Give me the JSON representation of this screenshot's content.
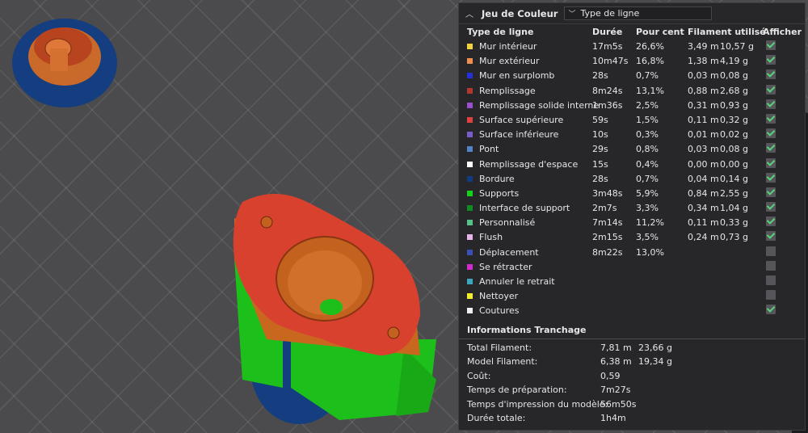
{
  "panel": {
    "title": "Jeu de Couleur",
    "dropdown_value": "Type de ligne",
    "headers": {
      "type": "Type de ligne",
      "duration": "Durée",
      "percent": "Pour cent",
      "filament": "Filament utilisé",
      "show": "Afficher"
    },
    "rows": [
      {
        "color": "#f0d33f",
        "name": "Mur intérieur",
        "duration": "17m5s",
        "percent": "26,6%",
        "length": "3,49 m",
        "weight": "10,57 g",
        "visible": true
      },
      {
        "color": "#ef8e4e",
        "name": "Mur extérieur",
        "duration": "10m47s",
        "percent": "16,8%",
        "length": "1,38 m",
        "weight": "4,19 g",
        "visible": true
      },
      {
        "color": "#2431d8",
        "name": "Mur en surplomb",
        "duration": "28s",
        "percent": "0,7%",
        "length": "0,03 m",
        "weight": "0,08 g",
        "visible": true
      },
      {
        "color": "#b3362f",
        "name": "Remplissage",
        "duration": "8m24s",
        "percent": "13,1%",
        "length": "0,88 m",
        "weight": "2,68 g",
        "visible": true
      },
      {
        "color": "#9a4fd1",
        "name": "Remplissage solide interne",
        "duration": "1m36s",
        "percent": "2,5%",
        "length": "0,31 m",
        "weight": "0,93 g",
        "visible": true
      },
      {
        "color": "#e0403f",
        "name": "Surface supérieure",
        "duration": "59s",
        "percent": "1,5%",
        "length": "0,11 m",
        "weight": "0,32 g",
        "visible": true
      },
      {
        "color": "#7b5ccf",
        "name": "Surface inférieure",
        "duration": "10s",
        "percent": "0,3%",
        "length": "0,01 m",
        "weight": "0,02 g",
        "visible": true
      },
      {
        "color": "#5283c4",
        "name": "Pont",
        "duration": "29s",
        "percent": "0,8%",
        "length": "0,03 m",
        "weight": "0,08 g",
        "visible": true
      },
      {
        "color": "#ffffff",
        "name": "Remplissage d'espace",
        "duration": "15s",
        "percent": "0,4%",
        "length": "0,00 m",
        "weight": "0,00 g",
        "visible": true
      },
      {
        "color": "#133b80",
        "name": "Bordure",
        "duration": "28s",
        "percent": "0,7%",
        "length": "0,04 m",
        "weight": "0,14 g",
        "visible": true
      },
      {
        "color": "#13d21c",
        "name": "Supports",
        "duration": "3m48s",
        "percent": "5,9%",
        "length": "0,84 m",
        "weight": "2,55 g",
        "visible": true
      },
      {
        "color": "#0f8a24",
        "name": "Interface de support",
        "duration": "2m7s",
        "percent": "3,3%",
        "length": "0,34 m",
        "weight": "1,04 g",
        "visible": true
      },
      {
        "color": "#56c28a",
        "name": "Personnalisé",
        "duration": "7m14s",
        "percent": "11,2%",
        "length": "0,11 m",
        "weight": "0,33 g",
        "visible": true
      },
      {
        "color": "#e8b3ea",
        "name": "Flush",
        "duration": "2m15s",
        "percent": "3,5%",
        "length": "0,24 m",
        "weight": "0,73 g",
        "visible": true
      },
      {
        "color": "#3c4fb5",
        "name": "Déplacement",
        "duration": "8m22s",
        "percent": "13,0%",
        "length": "",
        "weight": "",
        "visible": false
      },
      {
        "color": "#d22bcf",
        "name": "Se rétracter",
        "duration": "",
        "percent": "",
        "length": "",
        "weight": "",
        "visible": false
      },
      {
        "color": "#3aa6c2",
        "name": "Annuler le retrait",
        "duration": "",
        "percent": "",
        "length": "",
        "weight": "",
        "visible": false
      },
      {
        "color": "#f2ef2a",
        "name": "Nettoyer",
        "duration": "",
        "percent": "",
        "length": "",
        "weight": "",
        "visible": false
      },
      {
        "color": "#f0f0f0",
        "name": "Coutures",
        "duration": "",
        "percent": "",
        "length": "",
        "weight": "",
        "visible": true
      }
    ]
  },
  "info": {
    "title": "Informations Tranchage",
    "rows": [
      {
        "label": "Total Filament:",
        "v1": "7,81 m",
        "v2": "23,66 g"
      },
      {
        "label": "Model Filament:",
        "v1": "6,38 m",
        "v2": "19,34 g"
      },
      {
        "label": "Coût:",
        "v1": "0,59",
        "v2": ""
      },
      {
        "label": "Temps de préparation:",
        "v1": "7m27s",
        "v2": ""
      },
      {
        "label": "Temps d'impression du modèle:",
        "v1": "56m50s",
        "v2": ""
      },
      {
        "label": "Durée totale:",
        "v1": "1h4m",
        "v2": ""
      }
    ]
  }
}
